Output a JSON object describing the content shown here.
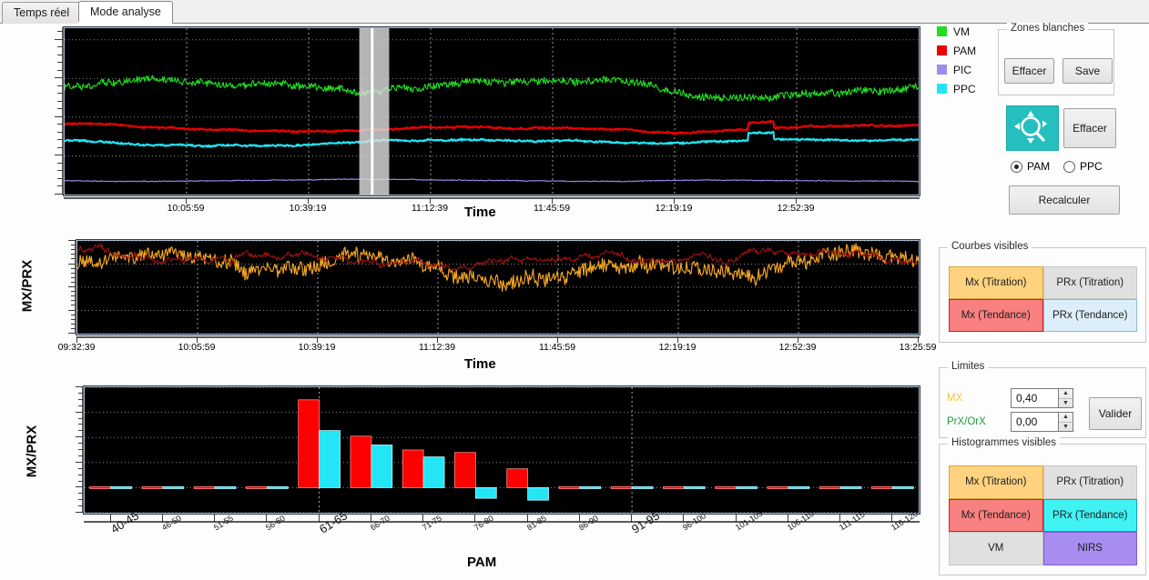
{
  "tabs": [
    {
      "label": "Temps réel",
      "active": false
    },
    {
      "label": "Mode analyse",
      "active": true
    }
  ],
  "legend": [
    {
      "label": "VM",
      "color": "#22dd22"
    },
    {
      "label": "PAM",
      "color": "#ee0000"
    },
    {
      "label": "PIC",
      "color": "#9c8cf0"
    },
    {
      "label": "PPC",
      "color": "#22e5f5"
    }
  ],
  "panels": {
    "zones_blanches": {
      "title": "Zones blanches",
      "effacer_label": "Effacer",
      "save_label": "Save"
    },
    "zoom_tools": {
      "magnifier_icon": "zoom-pan-magnifier-icon",
      "effacer_label": "Effacer",
      "radios": [
        {
          "label": "PAM",
          "checked": true
        },
        {
          "label": "PPC",
          "checked": false
        }
      ],
      "recalculer_label": "Recalculer"
    },
    "courbes_visibles": {
      "title": "Courbes visibles",
      "items": [
        {
          "label": "Mx (Titration)",
          "style": "mx-tit"
        },
        {
          "label": "PRx (Titration)",
          "style": "prx-tit"
        },
        {
          "label": "Mx (Tendance)",
          "style": "mx-ten"
        },
        {
          "label": "PRx (Tendance)",
          "style": "prx-ten-l"
        }
      ]
    },
    "limites": {
      "title": "Limites",
      "rows": [
        {
          "label": "MX",
          "label_color": "#e8c54a",
          "value": "0,40"
        },
        {
          "label": "PrX/OrX",
          "label_color": "#1f9d3a",
          "value": "0,00"
        }
      ],
      "valider_label": "Valider",
      "spin_up_icon": "chevron-up-icon",
      "spin_down_icon": "chevron-down-icon"
    },
    "histogrammes_visibles": {
      "title": "Histogrammes visibles",
      "items": [
        {
          "label": "Mx (Titration)",
          "style": "mx-tit"
        },
        {
          "label": "PRx (Titration)",
          "style": "prx-tit"
        },
        {
          "label": "Mx (Tendance)",
          "style": "mx-ten"
        },
        {
          "label": "PRx (Tendance)",
          "style": "prx-ten-c"
        },
        {
          "label": "VM",
          "style": "vm"
        },
        {
          "label": "NIRS",
          "style": "nirs"
        }
      ]
    }
  },
  "chart_data": [
    {
      "id": "vitals-timeseries",
      "type": "line",
      "title": "",
      "xlabel": "Time",
      "ylabel": "",
      "ylim": [
        0,
        215
      ],
      "yticks": [
        50,
        100,
        150,
        200
      ],
      "xticks": [
        "10:05:59",
        "10:39:19",
        "11:12:39",
        "11:45:59",
        "12:19:19",
        "12:52:39"
      ],
      "grid": true,
      "background": "#000000",
      "selection_band": {
        "label": "zone-blanche-selection",
        "color": "#d8d8d8"
      },
      "series": [
        {
          "name": "VM",
          "color": "#22dd22",
          "baseline": 138,
          "amplitude": 16,
          "noise": 9
        },
        {
          "name": "PAM",
          "color": "#ee0000",
          "baseline": 86,
          "amplitude": 7,
          "noise": 2
        },
        {
          "name": "PPC",
          "color": "#22e5f5",
          "baseline": 68,
          "amplitude": 7,
          "noise": 2
        },
        {
          "name": "PIC",
          "color": "#9c8cf0",
          "baseline": 18,
          "amplitude": 2,
          "noise": 1
        }
      ]
    },
    {
      "id": "mx-prx-timeseries",
      "type": "line",
      "title": "",
      "xlabel": "Time",
      "ylabel": "MX/PRX",
      "ylim": [
        -1,
        1
      ],
      "yticks": [
        "1",
        "0,5",
        "0",
        "-0,5",
        "-1"
      ],
      "xticks": [
        "09:32:39",
        "10:05:59",
        "10:39:19",
        "11:12:39",
        "11:45:59",
        "12:19:19",
        "12:52:39",
        "13:25:59"
      ],
      "grid": true,
      "background": "#000000",
      "series": [
        {
          "name": "Mx (Titration)",
          "color": "#f5a623",
          "baseline": 0.42,
          "amplitude": 0.38,
          "noise": 0.3
        },
        {
          "name": "Mx (Tendance)",
          "color": "#9e1010",
          "baseline": 0.62,
          "amplitude": 0.22,
          "noise": 0.08
        }
      ]
    },
    {
      "id": "pam-histogram",
      "type": "bar",
      "title": "",
      "xlabel": "PAM",
      "ylabel": "MX/PRX",
      "ylim": [
        -0.2,
        0.8
      ],
      "yticks": [
        "0,8",
        "0,6",
        "0,4",
        "0,2",
        "0",
        "-0,2"
      ],
      "grid": true,
      "background": "#000000",
      "categories": [
        "40-45",
        "46-50",
        "51-55",
        "56-60",
        "61-65",
        "66-70",
        "71-75",
        "76-80",
        "81-85",
        "86-90",
        "91-95",
        "96-100",
        "101-105",
        "106-110",
        "111-115",
        "116-120"
      ],
      "series": [
        {
          "name": "Mx (Tendance)",
          "color": "#ff0000",
          "values": [
            0.0,
            0.0,
            0.0,
            0.0,
            0.7,
            0.41,
            0.3,
            0.28,
            0.15,
            0.0,
            0.0,
            0.0,
            0.0,
            0.0,
            0.0,
            0.0
          ]
        },
        {
          "name": "PRx (Tendance)",
          "color": "#22e5f5",
          "values": [
            0.0,
            0.0,
            0.0,
            0.0,
            0.455,
            0.34,
            0.245,
            -0.085,
            -0.1,
            0.0,
            0.0,
            0.0,
            0.0,
            0.0,
            0.0,
            0.0
          ]
        }
      ]
    }
  ]
}
